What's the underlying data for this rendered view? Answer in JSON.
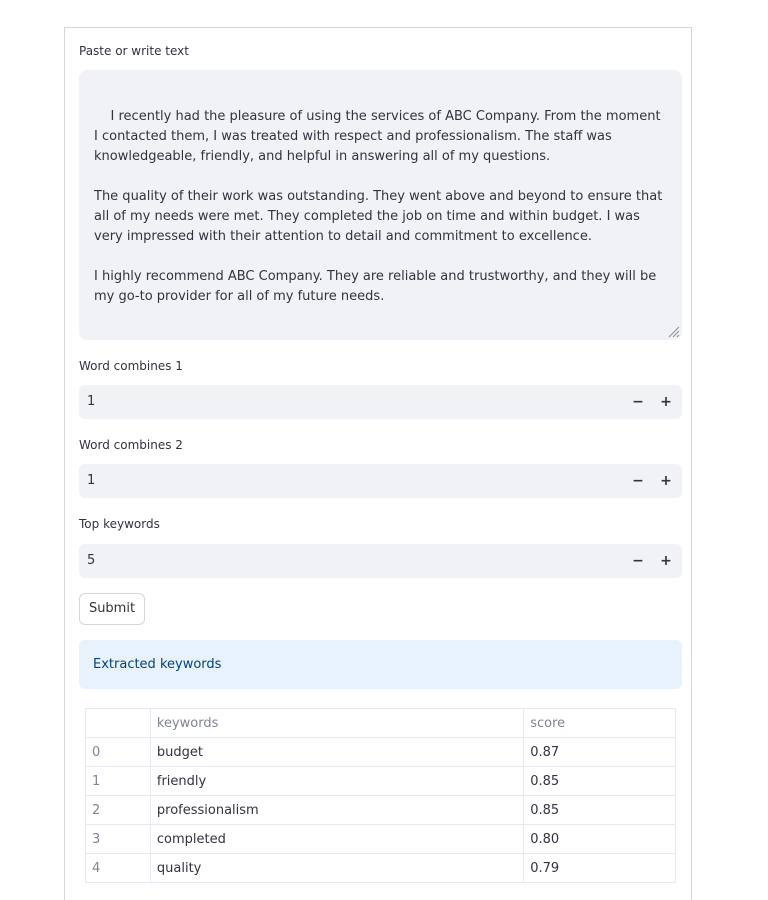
{
  "text_area": {
    "label": "Paste or write text",
    "value": "I recently had the pleasure of using the services of ABC Company. From the moment I contacted them, I was treated with respect and professionalism. The staff was knowledgeable, friendly, and helpful in answering all of my questions.\n\nThe quality of their work was outstanding. They went above and beyond to ensure that all of my needs were met. They completed the job on time and within budget. I was very impressed with their attention to detail and commitment to excellence.\n\nI highly recommend ABC Company. They are reliable and trustworthy, and they will be my go-to provider for all of my future needs."
  },
  "inputs": [
    {
      "label": "Word combines 1",
      "value": "1",
      "minus": "−",
      "plus": "+"
    },
    {
      "label": "Word combines 2",
      "value": "1",
      "minus": "−",
      "plus": "+"
    },
    {
      "label": "Top keywords",
      "value": "5",
      "minus": "−",
      "plus": "+"
    }
  ],
  "submit_label": "Submit",
  "info_message": "Extracted keywords",
  "table": {
    "columns": [
      "",
      "keywords",
      "score"
    ],
    "rows": [
      {
        "index": "0",
        "keyword": "budget",
        "score": "0.87"
      },
      {
        "index": "1",
        "keyword": "friendly",
        "score": "0.85"
      },
      {
        "index": "2",
        "keyword": "professionalism",
        "score": "0.85"
      },
      {
        "index": "3",
        "keyword": "completed",
        "score": "0.80"
      },
      {
        "index": "4",
        "keyword": "quality",
        "score": "0.79"
      }
    ]
  },
  "colors": {
    "input_bg": "#f0f2f6",
    "info_bg": "#e8f2fc",
    "info_text": "#004280",
    "text": "#31333f",
    "muted": "#808495"
  },
  "icons": {
    "resize": "resize-handle-icon",
    "minus": "minus-icon",
    "plus": "plus-icon"
  }
}
